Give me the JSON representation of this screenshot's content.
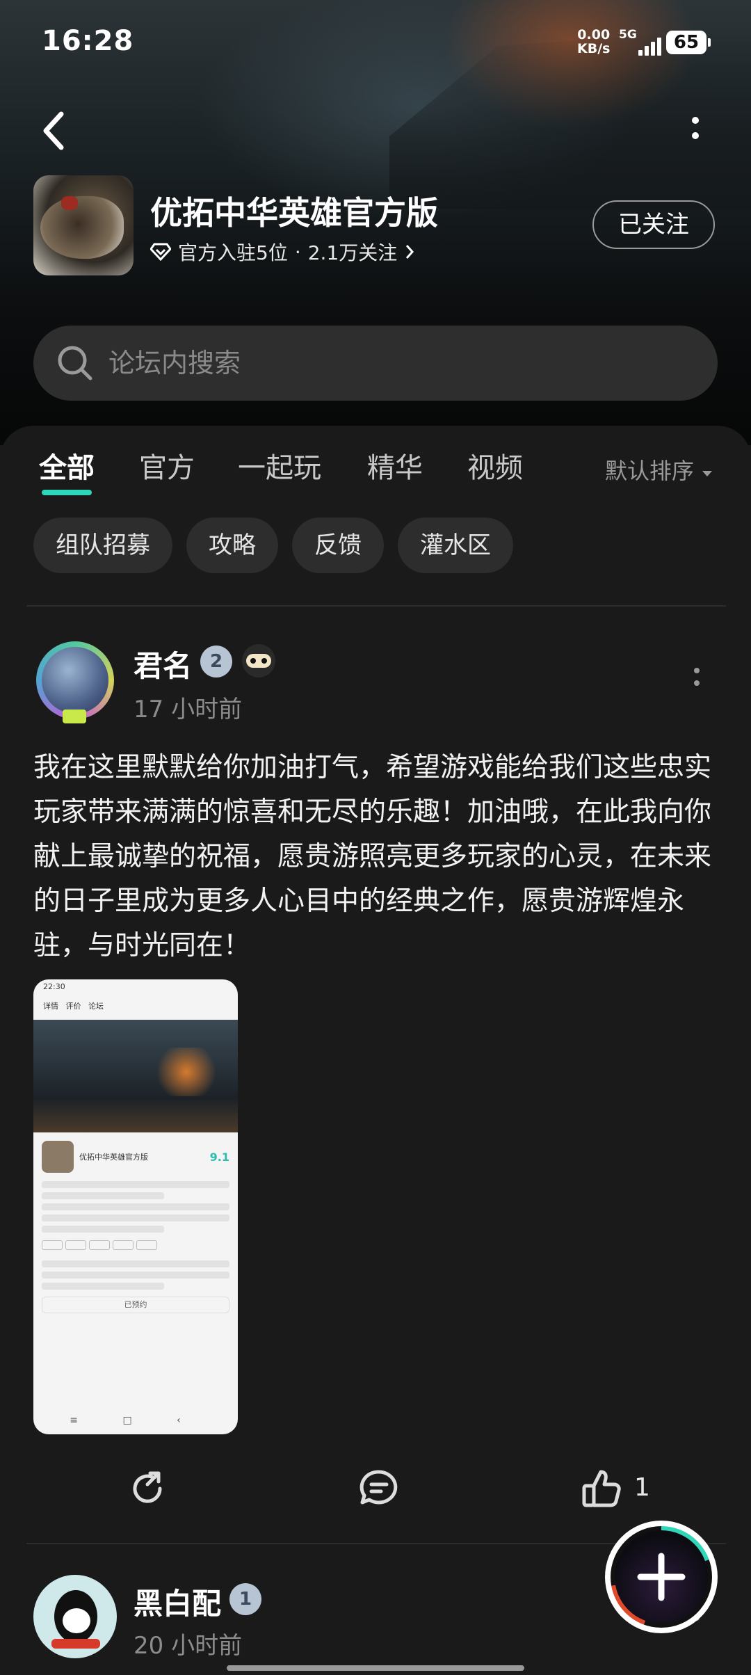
{
  "status_bar": {
    "time": "16:28",
    "speed_value": "0.00",
    "speed_unit": "KB/s",
    "network": "5G",
    "battery": "65"
  },
  "forum": {
    "title": "优拓中华英雄官方版",
    "meta_official": "官方入驻5位",
    "meta_sep": "·",
    "meta_followers": "2.1万关注",
    "follow_label": "已关注",
    "search_placeholder": "论坛内搜索"
  },
  "tabs": [
    "全部",
    "官方",
    "一起玩",
    "精华",
    "视频"
  ],
  "sort_label": "默认排序",
  "chips": [
    "组队招募",
    "攻略",
    "反馈",
    "灌水区"
  ],
  "posts": [
    {
      "username": "君名",
      "level": "2",
      "time": "17 小时前",
      "content": "我在这里默默给你加油打气，希望游戏能给我们这些忠实玩家带来满满的惊喜和无尽的乐趣！加油哦，在此我向你献上最诚挚的祝福，愿贵游照亮更多玩家的心灵，在未来的日子里成为更多人心目中的经典之作，愿贵游辉煌永驻，与时光同在！",
      "likes": "1",
      "screenshot": {
        "time": "22:30",
        "tabs": [
          "详情",
          "评价",
          "论坛"
        ],
        "app_name": "优拓中华英雄官方版",
        "score": "9.1",
        "reserve": "已预约"
      }
    },
    {
      "username": "黑白配",
      "level": "1",
      "time": "20 小时前"
    }
  ],
  "colors": {
    "accent": "#2fd6b8",
    "background": "#1a1a1a",
    "chip": "#2d2d2d"
  }
}
